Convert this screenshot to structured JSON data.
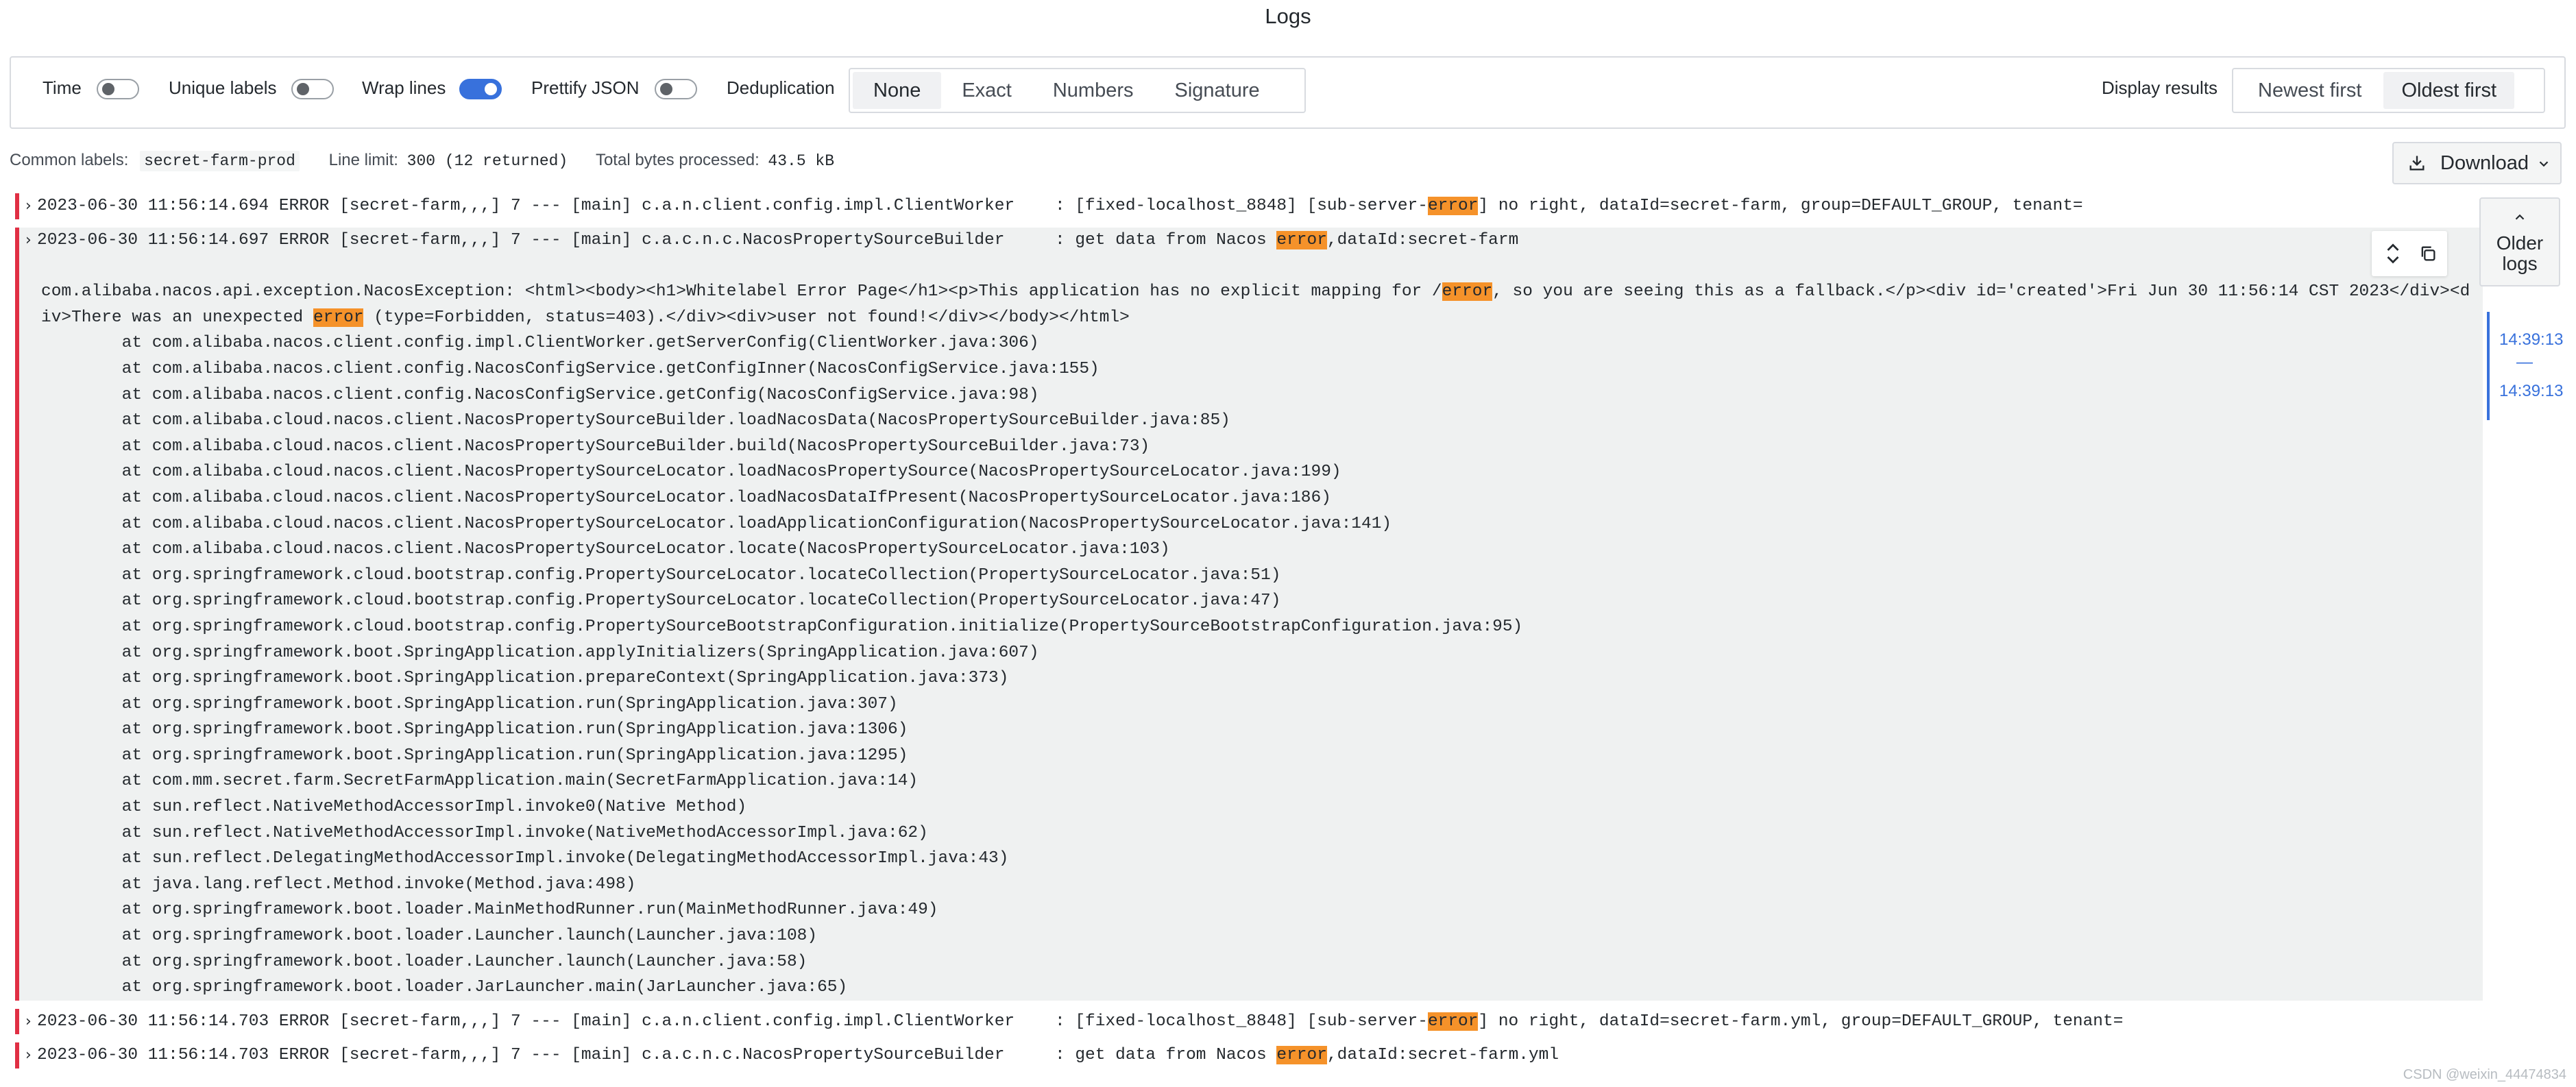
{
  "page": {
    "title": "Logs"
  },
  "options": {
    "time_label": "Time",
    "time_on": false,
    "unique_labels_label": "Unique labels",
    "unique_labels_on": false,
    "wrap_lines_label": "Wrap lines",
    "wrap_lines_on": true,
    "prettify_json_label": "Prettify JSON",
    "prettify_json_on": false,
    "dedup_label": "Deduplication",
    "dedup_options": [
      "None",
      "Exact",
      "Numbers",
      "Signature"
    ],
    "dedup_selected": "None",
    "display_results_label": "Display results",
    "order_options": [
      "Newest first",
      "Oldest first"
    ],
    "order_selected": "Oldest first"
  },
  "meta": {
    "common_labels_label": "Common labels:",
    "common_labels_value": "secret-farm-prod",
    "line_limit_label": "Line limit:",
    "line_limit_value": "300 (12 returned)",
    "bytes_label": "Total bytes processed:",
    "bytes_value": "43.5 kB"
  },
  "download": {
    "label": "Download"
  },
  "logs": {
    "row1": {
      "pre": "2023-06-30 11:56:14.694 ERROR [secret-farm,,,] 7 --- [main] c.a.n.client.config.impl.ClientWorker    : [fixed-localhost_8848] [sub-server-",
      "hl": "error",
      "post": "] no right, dataId=secret-farm, group=DEFAULT_GROUP, tenant="
    },
    "row2": {
      "pre": "2023-06-30 11:56:14.697 ERROR [secret-farm,,,] 7 --- [main] c.a.c.n.c.NacosPropertySourceBuilder     : get data from Nacos ",
      "hl": "error",
      "post": ",dataId:secret-farm"
    },
    "detail": {
      "msg_a": "com.alibaba.nacos.api.exception.NacosException: <html><body><h1>Whitelabel Error Page</h1><p>This application has no explicit mapping for /",
      "msg_hl1": "error",
      "msg_b": ", so you are seeing this as a fallback.</p><div id='created'>Fri Jun 30 11:56:14 CST 2023</div><div>There was an unexpected ",
      "msg_hl2": "error",
      "msg_c": " (type=Forbidden, status=403).</div><div>user not found!</div></body></html>",
      "frames": [
        "        at com.alibaba.nacos.client.config.impl.ClientWorker.getServerConfig(ClientWorker.java:306)",
        "        at com.alibaba.nacos.client.config.NacosConfigService.getConfigInner(NacosConfigService.java:155)",
        "        at com.alibaba.nacos.client.config.NacosConfigService.getConfig(NacosConfigService.java:98)",
        "        at com.alibaba.cloud.nacos.client.NacosPropertySourceBuilder.loadNacosData(NacosPropertySourceBuilder.java:85)",
        "        at com.alibaba.cloud.nacos.client.NacosPropertySourceBuilder.build(NacosPropertySourceBuilder.java:73)",
        "        at com.alibaba.cloud.nacos.client.NacosPropertySourceLocator.loadNacosPropertySource(NacosPropertySourceLocator.java:199)",
        "        at com.alibaba.cloud.nacos.client.NacosPropertySourceLocator.loadNacosDataIfPresent(NacosPropertySourceLocator.java:186)",
        "        at com.alibaba.cloud.nacos.client.NacosPropertySourceLocator.loadApplicationConfiguration(NacosPropertySourceLocator.java:141)",
        "        at com.alibaba.cloud.nacos.client.NacosPropertySourceLocator.locate(NacosPropertySourceLocator.java:103)",
        "        at org.springframework.cloud.bootstrap.config.PropertySourceLocator.locateCollection(PropertySourceLocator.java:51)",
        "        at org.springframework.cloud.bootstrap.config.PropertySourceLocator.locateCollection(PropertySourceLocator.java:47)",
        "        at org.springframework.cloud.bootstrap.config.PropertySourceBootstrapConfiguration.initialize(PropertySourceBootstrapConfiguration.java:95)",
        "        at org.springframework.boot.SpringApplication.applyInitializers(SpringApplication.java:607)",
        "        at org.springframework.boot.SpringApplication.prepareContext(SpringApplication.java:373)",
        "        at org.springframework.boot.SpringApplication.run(SpringApplication.java:307)",
        "        at org.springframework.boot.SpringApplication.run(SpringApplication.java:1306)",
        "        at org.springframework.boot.SpringApplication.run(SpringApplication.java:1295)",
        "        at com.mm.secret.farm.SecretFarmApplication.main(SecretFarmApplication.java:14)",
        "        at sun.reflect.NativeMethodAccessorImpl.invoke0(Native Method)",
        "        at sun.reflect.NativeMethodAccessorImpl.invoke(NativeMethodAccessorImpl.java:62)",
        "        at sun.reflect.DelegatingMethodAccessorImpl.invoke(DelegatingMethodAccessorImpl.java:43)",
        "        at java.lang.reflect.Method.invoke(Method.java:498)",
        "        at org.springframework.boot.loader.MainMethodRunner.run(MainMethodRunner.java:49)",
        "        at org.springframework.boot.loader.Launcher.launch(Launcher.java:108)",
        "        at org.springframework.boot.loader.Launcher.launch(Launcher.java:58)",
        "        at org.springframework.boot.loader.JarLauncher.main(JarLauncher.java:65)"
      ]
    },
    "row3": {
      "pre": "2023-06-30 11:56:14.703 ERROR [secret-farm,,,] 7 --- [main] c.a.n.client.config.impl.ClientWorker    : [fixed-localhost_8848] [sub-server-",
      "hl": "error",
      "post": "] no right, dataId=secret-farm.yml, group=DEFAULT_GROUP, tenant="
    },
    "row4": {
      "pre": "2023-06-30 11:56:14.703 ERROR [secret-farm,,,] 7 --- [main] c.a.c.n.c.NacosPropertySourceBuilder     : get data from Nacos ",
      "hl": "error",
      "post": ",dataId:secret-farm.yml"
    }
  },
  "older_logs": {
    "label": "Older logs"
  },
  "navigator": {
    "start": "14:39:13",
    "sep": "—",
    "end": "14:39:13"
  },
  "icons": {
    "chevron": "chevron-right-icon",
    "download": "download-icon",
    "expand": "expand-vertical-icon",
    "copy": "copy-icon"
  },
  "watermark": "CSDN @weixin_44474834",
  "colors": {
    "accent": "#3871dc",
    "error_bar": "#e02f44",
    "highlight": "#f5922a"
  }
}
